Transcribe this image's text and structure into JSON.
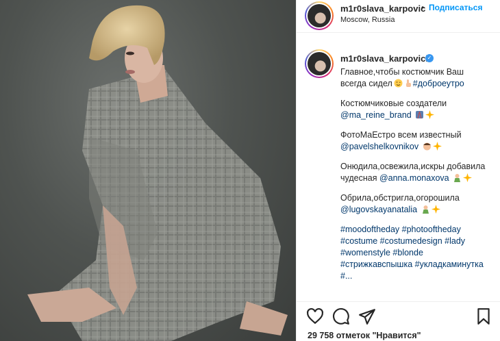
{
  "post": {
    "username": "m1r0slava_karpovich",
    "username_short": "m1r0slava_karpovic",
    "separator": "•",
    "follow_label": "Подписаться",
    "location": "Moscow, Russia"
  },
  "caption": {
    "line1": "Главное,чтобы костюмчик Ваш",
    "line2": "всегда сидел",
    "tag_good_morning": "#доброеутро",
    "p2_text": "Костюмчиковые создатели",
    "p2_link": "@ma_reine_brand",
    "p3_text": "ФотоМаЕстро всем известный",
    "p3_link": "@pavelshelkovnikov",
    "p4_text": "Онюдила,освежила,искры добавила",
    "p4_prefix": "чудесная ",
    "p4_link": "@anna.monaxova",
    "p5_text": "Обрила,обстригла,огорошила",
    "p5_link": "@lugovskayanatalia",
    "hashtags": [
      "#moodoftheday #photooftheday",
      "#costume #costumedesign #lady",
      "#womenstyle #blonde",
      "#стрижкавспышка #укладкаминутка",
      "#..."
    ]
  },
  "footer": {
    "likes_text": "29 758 отметок \"Нравится\""
  },
  "icons": [
    "heart-icon",
    "comment-icon",
    "share-icon",
    "bookmark-icon",
    "verified-badge-icon"
  ],
  "colors": {
    "accent": "#0095f6",
    "link": "#00376b",
    "text": "#262626",
    "verified": "#3897f0"
  }
}
